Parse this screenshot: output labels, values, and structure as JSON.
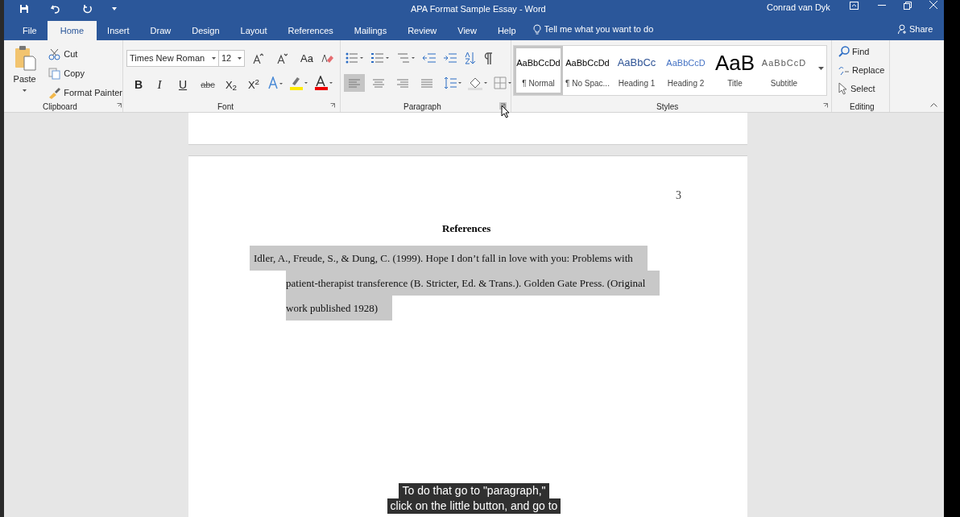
{
  "window": {
    "title": "APA Format Sample Essay  -  Word",
    "user": "Conrad van Dyk"
  },
  "tabs": [
    {
      "label": "File",
      "selected": false
    },
    {
      "label": "Home",
      "selected": true
    },
    {
      "label": "Insert",
      "selected": false
    },
    {
      "label": "Draw",
      "selected": false
    },
    {
      "label": "Design",
      "selected": false
    },
    {
      "label": "Layout",
      "selected": false
    },
    {
      "label": "References",
      "selected": false
    },
    {
      "label": "Mailings",
      "selected": false
    },
    {
      "label": "Review",
      "selected": false
    },
    {
      "label": "View",
      "selected": false
    },
    {
      "label": "Help",
      "selected": false
    }
  ],
  "tell_me": {
    "placeholder": "Tell me what you want to do"
  },
  "share": "Share",
  "clipboard": {
    "paste": "Paste",
    "items": [
      "Cut",
      "Copy",
      "Format Painter"
    ],
    "label": "Clipboard"
  },
  "font": {
    "name": "Times New Roman",
    "size": "12",
    "change_case": "Aa",
    "format_buttons": [
      "B",
      "I",
      "U",
      "abc",
      "X$_{2}$",
      "X$^{2}$"
    ],
    "label": "Font"
  },
  "paragraph": {
    "alignment": [
      {
        "selected": true
      },
      {
        "selected": false
      },
      {
        "selected": false
      },
      {
        "selected": false
      }
    ],
    "label": "Paragraph"
  },
  "styles": {
    "items": [
      {
        "sample": "AaBbCcDd",
        "name": "¶ Normal",
        "kind": "normal",
        "selected": true
      },
      {
        "sample": "AaBbCcDd",
        "name": "¶ No Spac...",
        "kind": "normal",
        "selected": false
      },
      {
        "sample": "AaBbCc",
        "name": "Heading 1",
        "kind": "heading1",
        "selected": false
      },
      {
        "sample": "AaBbCcD",
        "name": "Heading 2",
        "kind": "heading2",
        "selected": false
      },
      {
        "sample": "AaB",
        "name": "Title",
        "kind": "title",
        "selected": false
      },
      {
        "sample": "AaBbCcD",
        "name": "Subtitle",
        "kind": "subtitle",
        "selected": false
      }
    ],
    "label": "Styles"
  },
  "editing": {
    "items": [
      "Find",
      "Replace",
      "Select"
    ],
    "label": "Editing"
  },
  "document": {
    "page_number": "3",
    "heading": "References",
    "reference_lines": [
      {
        "text": "Idler, A., Freude, S., & Dung, C. (1999). Hope I don’t fall in love with you: Problems with",
        "selected": true
      },
      {
        "text": "patient-therapist transference (B. Stricter, Ed. & Trans.). Golden Gate Press. (Original",
        "selected": true
      },
      {
        "text": "work published 1928)",
        "selected": true
      }
    ]
  },
  "captions": [
    "To do that go to \"paragraph,\"",
    "click on the little button, and go to"
  ]
}
